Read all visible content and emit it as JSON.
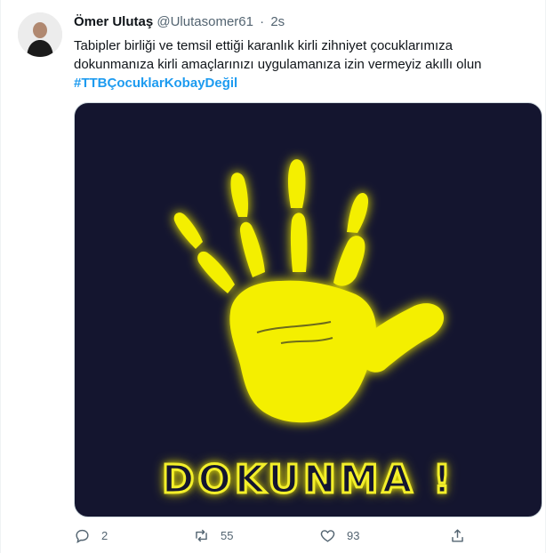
{
  "author": {
    "display_name": "Ömer Ulutaş",
    "handle": "@Ulutasomer61",
    "separator": "·",
    "time": "2s"
  },
  "tweet": {
    "text_line1": "Tabipler birliği ve temsil ettiği karanlık kirli zihniyet çocuklarımıza",
    "text_line2": "dokunmanıza kirli amaçlarınızı uygulamanıza izin vermeyiz akıllı olun",
    "hashtag": "#TTBÇocuklarKobayDeğil"
  },
  "media": {
    "caption": "DOKUNMA !",
    "background_color": "#14152f",
    "glow_color": "#f3ef2a"
  },
  "actions": {
    "reply_count": "2",
    "retweet_count": "55",
    "like_count": "93"
  },
  "colors": {
    "text_primary": "#0f1419",
    "text_secondary": "#536471",
    "link": "#1d9bf0"
  }
}
